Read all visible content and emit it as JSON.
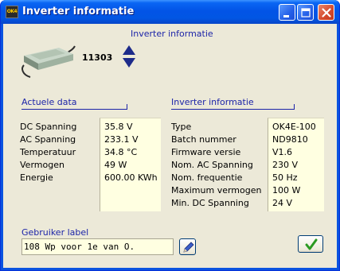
{
  "window": {
    "title": "Inverter informatie",
    "icon_name": "ok4-app-icon",
    "icon_text": "OK4",
    "controls": [
      "minimize-icon",
      "maximize-icon",
      "close-icon"
    ]
  },
  "header": {
    "title": "Inverter informatie",
    "inverter_number": "11303",
    "device_icon": "inverter-device-icon",
    "nav_up_icon": "triangle-up-icon",
    "nav_down_icon": "triangle-down-icon"
  },
  "actual_data": {
    "heading": "Actuele data",
    "rows": [
      {
        "label": "DC Spanning",
        "value": "35.8 V"
      },
      {
        "label": "AC Spanning",
        "value": "233.1 V"
      },
      {
        "label": "Temperatuur",
        "value": "34.8 °C"
      },
      {
        "label": "Vermogen",
        "value": "49 W"
      },
      {
        "label": "Energie",
        "value": "600.00 KWh"
      }
    ]
  },
  "inverter_info": {
    "heading": "Inverter informatie",
    "rows": [
      {
        "label": "Type",
        "value": "OK4E-100"
      },
      {
        "label": "Batch nummer",
        "value": "ND9810"
      },
      {
        "label": "Firmware versie",
        "value": "V1.6"
      },
      {
        "label": "Nom. AC Spanning",
        "value": "230 V"
      },
      {
        "label": "Nom. frequentie",
        "value": "50 Hz"
      },
      {
        "label": "Maximum vermogen",
        "value": "100 W"
      },
      {
        "label": "Min. DC Spanning",
        "value": "24 V"
      }
    ]
  },
  "user_label": {
    "heading": "Gebruiker label",
    "value": "108 Wp voor 1e van O.",
    "edit_icon": "pencil-icon"
  },
  "ok_button": {
    "icon": "checkmark-icon"
  },
  "colors": {
    "titlebar": "#0254e6",
    "client_bg": "#ece9d8",
    "heading_text": "#1c24a8",
    "value_bg": "#ffffe1",
    "checkmark": "#2a9a22"
  }
}
